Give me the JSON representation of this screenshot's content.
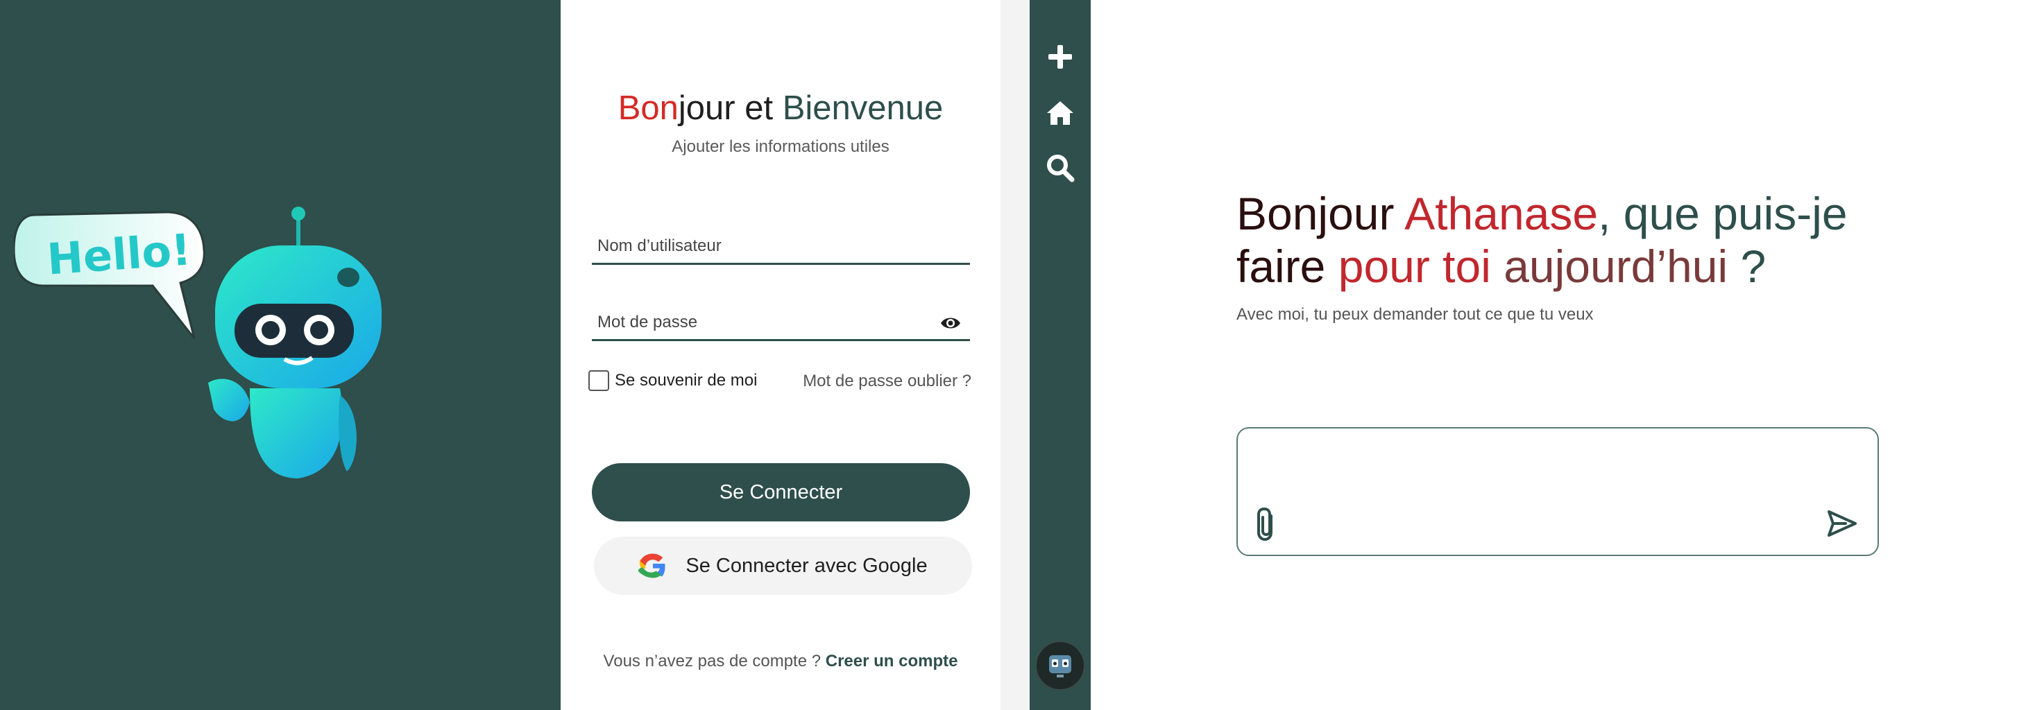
{
  "colors": {
    "brand": "#2e4f4b",
    "accent_red": "#d42a25",
    "panel_gray": "#f3f3f3"
  },
  "illustration": {
    "bubble_text": "Hello!"
  },
  "login": {
    "title_part1": "Bon",
    "title_part2": "jour et ",
    "title_part3": "Bienvenue",
    "subtitle": "Ajouter les informations utiles",
    "username_placeholder": "Nom d’utilisateur",
    "password_placeholder": "Mot de passe",
    "remember_label": "Se souvenir de moi",
    "forgot_label": "Mot de passe oublier ?",
    "connect_label": "Se Connecter",
    "google_label": "Se Connecter avec Google",
    "no_account_text": "Vous n’avez pas de compte ? ",
    "create_account_label": "Creer un compte"
  },
  "sidebar": {
    "items": [
      {
        "icon": "plus-icon"
      },
      {
        "icon": "home-icon"
      },
      {
        "icon": "search-icon"
      }
    ],
    "avatar_icon": "robot-avatar-icon"
  },
  "chat": {
    "greeting_part1": "Bonjour ",
    "greeting_name": "Athanase",
    "greeting_part2": ", que puis-je",
    "greeting_part3": "faire ",
    "greeting_part4": "pour toi ",
    "greeting_part5": "aujourd’hui",
    "greeting_part6": " ?",
    "subtitle": "Avec moi, tu peux demander tout ce que tu veux",
    "input_placeholder": "",
    "attach_icon": "paperclip-icon",
    "send_icon": "send-icon"
  }
}
